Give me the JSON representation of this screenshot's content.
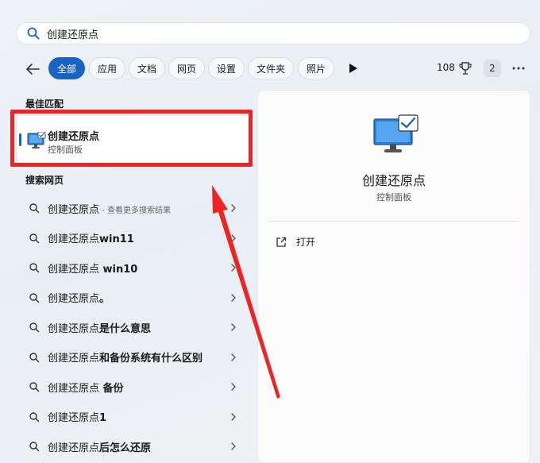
{
  "search": {
    "query": "创建还原点"
  },
  "filters": {
    "items": [
      "全部",
      "应用",
      "文档",
      "网页",
      "设置",
      "文件夹",
      "照片"
    ],
    "active_index": 0,
    "points": "108",
    "notification_count": "2"
  },
  "best_match": {
    "section_title": "最佳匹配",
    "title": "创建还原点",
    "subtitle": "控制面板"
  },
  "web": {
    "section_title": "搜索网页",
    "items": [
      {
        "base": "创建还原点",
        "bold": "",
        "hint": " - 查看更多搜索结果"
      },
      {
        "base": "创建还原点",
        "bold": "win11",
        "hint": ""
      },
      {
        "base": "创建还原点",
        "bold": " win10",
        "hint": ""
      },
      {
        "base": "创建还原点",
        "bold": "。",
        "hint": ""
      },
      {
        "base": "创建还原点",
        "bold": "是什么意思",
        "hint": ""
      },
      {
        "base": "创建还原点",
        "bold": "和备份系统有什么区别",
        "hint": ""
      },
      {
        "base": "创建还原点",
        "bold": " 备份",
        "hint": ""
      },
      {
        "base": "创建还原点",
        "bold": "1",
        "hint": ""
      },
      {
        "base": "创建还原点",
        "bold": "后怎么还原",
        "hint": ""
      }
    ]
  },
  "preview": {
    "title": "创建还原点",
    "subtitle": "控制面板",
    "action_open": "打开"
  },
  "colors": {
    "accent": "#1a63c5",
    "highlight_red": "#ee2424"
  }
}
